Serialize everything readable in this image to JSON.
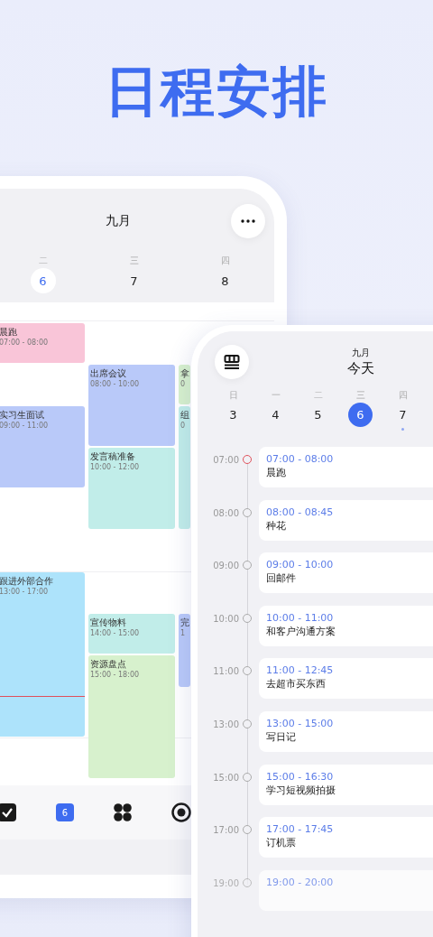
{
  "headline": "日程安排",
  "week_view": {
    "month": "九月",
    "days": [
      {
        "weekday": "二",
        "day": "6",
        "selected": true
      },
      {
        "weekday": "三",
        "day": "7",
        "selected": false
      },
      {
        "weekday": "四",
        "day": "8",
        "selected": false
      }
    ],
    "events": [
      {
        "title": "晨跑",
        "time": "07:00 - 08:00",
        "color": "#f9c5d8"
      },
      {
        "title": "实习生面试",
        "time": "09:00 - 11:00",
        "color": "#b9c9f9"
      },
      {
        "title": "跟进外部合作",
        "time": "13:00 - 17:00",
        "color": "#ade3fb"
      },
      {
        "title": "出席会议",
        "time": "08:00 - 10:00",
        "color": "#b9c9f9"
      },
      {
        "title": "发言稿准备",
        "time": "10:00 - 12:00",
        "color": "#c1ede9"
      },
      {
        "title": "宣传物料",
        "time": "14:00 - 15:00",
        "color": "#c1ede9"
      },
      {
        "title": "资源盘点",
        "time": "15:00 - 18:00",
        "color": "#d7f1cd"
      },
      {
        "title": "拿",
        "time": "0",
        "color": "#d7f1cd"
      },
      {
        "title": "组",
        "time": "0",
        "color": "#c1ede9"
      },
      {
        "title": "完",
        "time": "1",
        "color": "#b9c9f9"
      }
    ],
    "bottom_nav": [
      {
        "kind": "check",
        "selected": false
      },
      {
        "kind": "calendar",
        "label": "6",
        "selected": true
      },
      {
        "kind": "clover",
        "selected": false
      },
      {
        "kind": "target",
        "selected": false
      }
    ]
  },
  "day_view": {
    "month": "九月",
    "title": "今天",
    "days": [
      {
        "weekday": "日",
        "day": "3",
        "selected": false,
        "has_events": false
      },
      {
        "weekday": "一",
        "day": "4",
        "selected": false,
        "has_events": false
      },
      {
        "weekday": "二",
        "day": "5",
        "selected": false,
        "has_events": false
      },
      {
        "weekday": "三",
        "day": "6",
        "selected": true,
        "has_events": false
      },
      {
        "weekday": "四",
        "day": "7",
        "selected": false,
        "has_events": true
      }
    ],
    "agenda": [
      {
        "hour": "07:00",
        "time": "07:00 - 08:00",
        "title": "晨跑",
        "current": true,
        "faded": false
      },
      {
        "hour": "08:00",
        "time": "08:00 - 08:45",
        "title": "种花",
        "current": false,
        "faded": false
      },
      {
        "hour": "09:00",
        "time": "09:00 - 10:00",
        "title": "回邮件",
        "current": false,
        "faded": false
      },
      {
        "hour": "10:00",
        "time": "10:00 - 11:00",
        "title": "和客户沟通方案",
        "current": false,
        "faded": false
      },
      {
        "hour": "11:00",
        "time": "11:00 - 12:45",
        "title": "去超市买东西",
        "current": false,
        "faded": false
      },
      {
        "hour": "13:00",
        "time": "13:00 - 15:00",
        "title": "写日记",
        "current": false,
        "faded": false
      },
      {
        "hour": "15:00",
        "time": "15:00 - 16:30",
        "title": "学习短视频拍摄",
        "current": false,
        "faded": false
      },
      {
        "hour": "17:00",
        "time": "17:00 - 17:45",
        "title": "订机票",
        "current": false,
        "faded": false
      },
      {
        "hour": "19:00",
        "time": "19:00 - 20:00",
        "current": false,
        "faded": true
      }
    ]
  }
}
